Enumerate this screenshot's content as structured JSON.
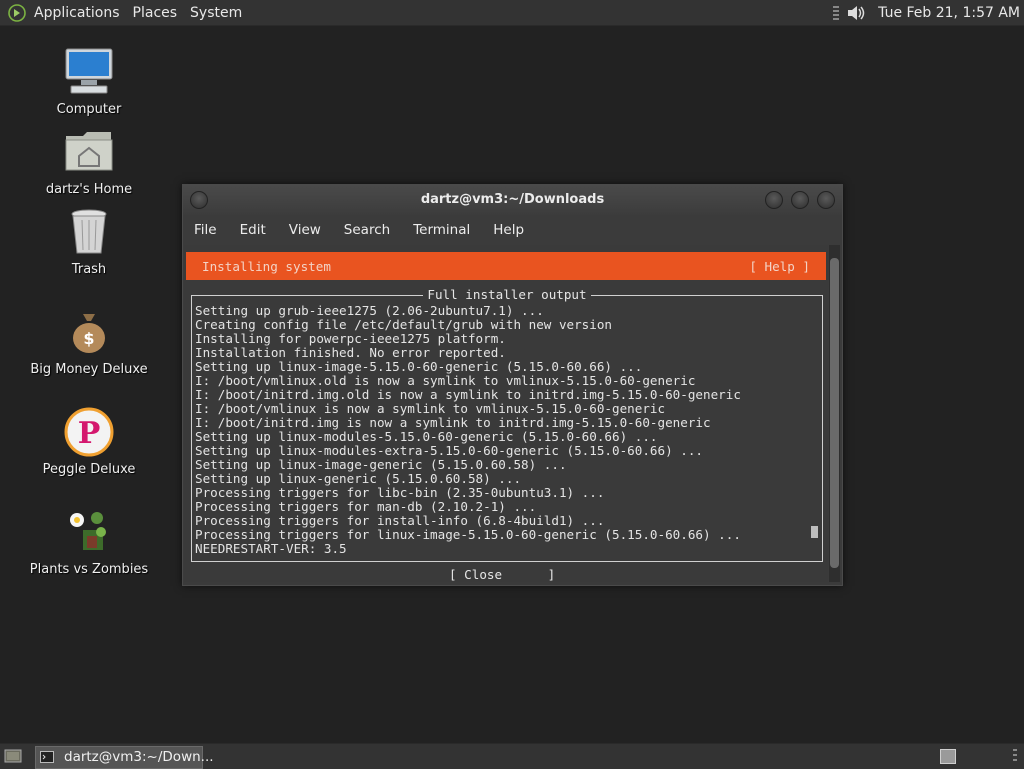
{
  "top_panel": {
    "menus": [
      "Applications",
      "Places",
      "System"
    ],
    "clock": "Tue Feb 21,  1:57 AM",
    "icons": [
      "gnome-foot-logo-icon",
      "volume-icon"
    ]
  },
  "desktop": {
    "icons": [
      {
        "label": "Computer",
        "icon": "computer-icon"
      },
      {
        "label": "dartz's Home",
        "icon": "home-folder-icon"
      },
      {
        "label": "Trash",
        "icon": "trash-icon"
      },
      {
        "label": "Big Money Deluxe",
        "icon": "money-bag-icon"
      },
      {
        "label": "Peggle Deluxe",
        "icon": "peggle-icon"
      },
      {
        "label": "Plants vs Zombies",
        "icon": "plants-vs-zombies-icon"
      }
    ]
  },
  "window": {
    "title": "dartz@vm3:~/Downloads",
    "menus": [
      "File",
      "Edit",
      "View",
      "Search",
      "Terminal",
      "Help"
    ]
  },
  "installer": {
    "header": "Installing system",
    "help": "[ Help ]",
    "output_title": "Full installer output",
    "lines": [
      "Setting up grub-ieee1275 (2.06-2ubuntu7.1) ...",
      "Creating config file /etc/default/grub with new version",
      "Installing for powerpc-ieee1275 platform.",
      "Installation finished. No error reported.",
      "Setting up linux-image-5.15.0-60-generic (5.15.0-60.66) ...",
      "I: /boot/vmlinux.old is now a symlink to vmlinux-5.15.0-60-generic",
      "I: /boot/initrd.img.old is now a symlink to initrd.img-5.15.0-60-generic",
      "I: /boot/vmlinux is now a symlink to vmlinux-5.15.0-60-generic",
      "I: /boot/initrd.img is now a symlink to initrd.img-5.15.0-60-generic",
      "Setting up linux-modules-5.15.0-60-generic (5.15.0-60.66) ...",
      "Setting up linux-modules-extra-5.15.0-60-generic (5.15.0-60.66) ...",
      "Setting up linux-image-generic (5.15.0.60.58) ...",
      "Setting up linux-generic (5.15.0.60.58) ...",
      "Processing triggers for libc-bin (2.35-0ubuntu3.1) ...",
      "Processing triggers for man-db (2.10.2-1) ...",
      "Processing triggers for install-info (6.8-4build1) ...",
      "Processing triggers for linux-image-5.15.0-60-generic (5.15.0-60.66) ...",
      "NEEDRESTART-VER: 3.5"
    ],
    "close": "[ Close      ]"
  },
  "bottom_panel": {
    "task_label": "dartz@vm3:~/Down..."
  },
  "colors": {
    "accent": "#e95420",
    "panel": "#333333",
    "desktop": "#222222"
  }
}
